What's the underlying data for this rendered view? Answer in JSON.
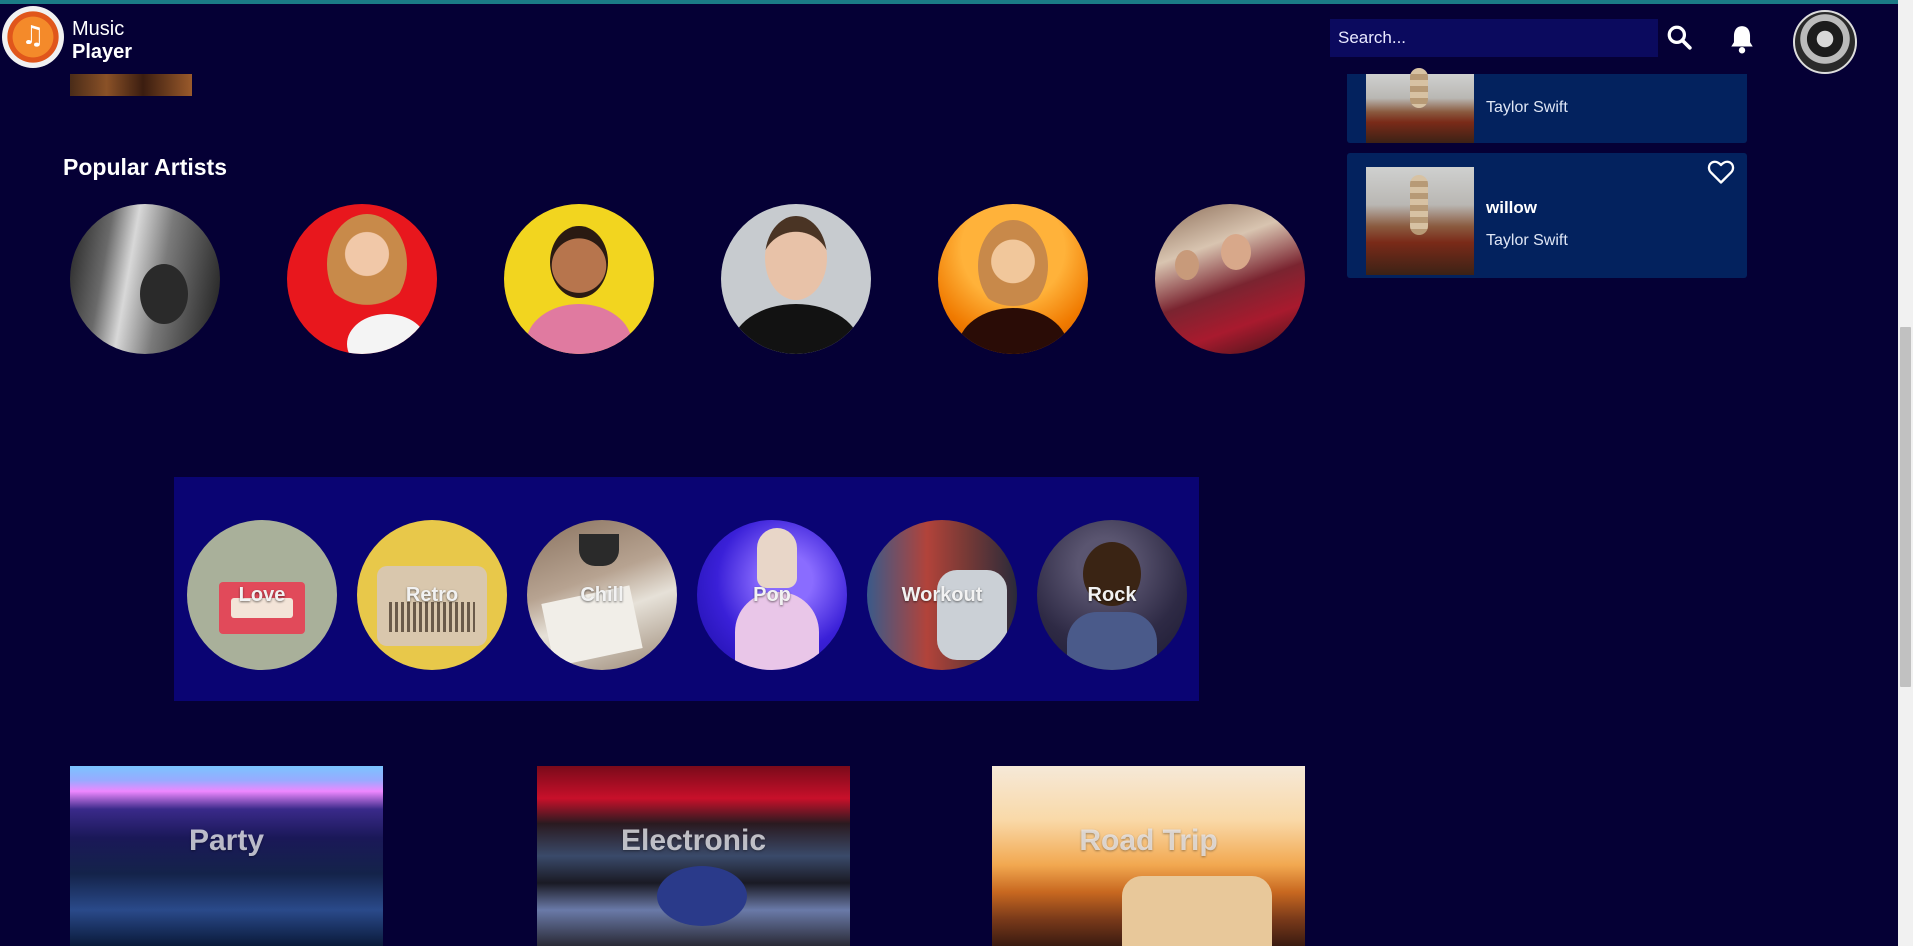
{
  "app": {
    "title_line1": "Music",
    "title_line2": "Player",
    "logo_icon": "music-note-icon"
  },
  "header": {
    "search_placeholder": "Search...",
    "search_icon": "search-icon",
    "bell_icon": "bell-icon"
  },
  "artists": {
    "title": "Popular Artists"
  },
  "categories": [
    {
      "label": "Love",
      "color": "#a9b09a"
    },
    {
      "label": "Retro",
      "color": "#e8c84a"
    },
    {
      "label": "Chill",
      "color": "#9a8774"
    },
    {
      "label": "Pop",
      "color": "#3a20d8"
    },
    {
      "label": "Workout",
      "color": "#6b4d52"
    },
    {
      "label": "Rock",
      "color": "#3a3550"
    }
  ],
  "moods": [
    {
      "label": "Party"
    },
    {
      "label": "Electronic"
    },
    {
      "label": "Road Trip"
    }
  ],
  "songs": [
    {
      "title": "",
      "artist": "Taylor Swift"
    },
    {
      "title": "willow",
      "artist": "Taylor Swift"
    }
  ],
  "colors": {
    "background": "#050035",
    "panel": "#0a0473",
    "card": "#03225e",
    "search_bg": "#0b0a5e"
  }
}
